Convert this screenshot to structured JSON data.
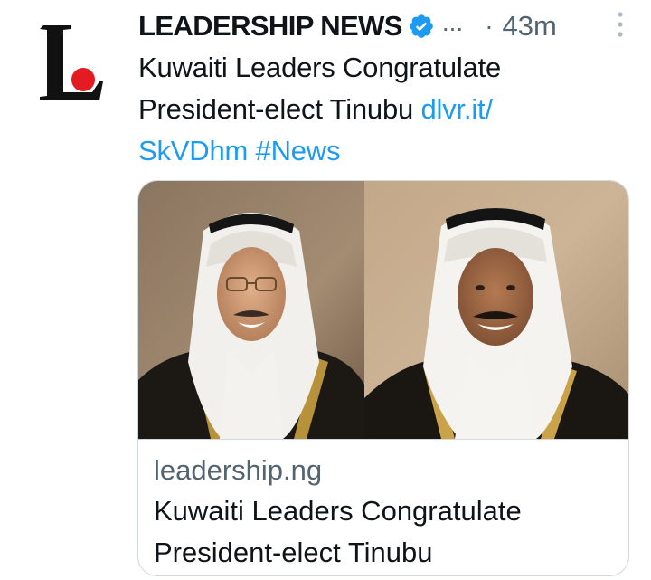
{
  "tweet": {
    "account_name": "LEADERSHIP NEWS",
    "handle_truncated": "...",
    "separator": "·",
    "time": "43m",
    "text": "Kuwaiti Leaders Congratulate President-elect Tinubu ",
    "link_text": "dlvr.it/",
    "link_text_2": "SkVDhm",
    "hashtag": "#News"
  },
  "card": {
    "domain": "leadership.ng",
    "title": "Kuwaiti Leaders Congratulate President-elect Tinubu"
  },
  "icons": {
    "avatar": "leadership-logo",
    "verified": "verified-badge-icon",
    "more": "more-vertical-icon"
  },
  "colors": {
    "link": "#1d9bf0",
    "secondary_text": "#536471",
    "verified": "#1d9bf0",
    "logo_red": "#e31b23"
  }
}
